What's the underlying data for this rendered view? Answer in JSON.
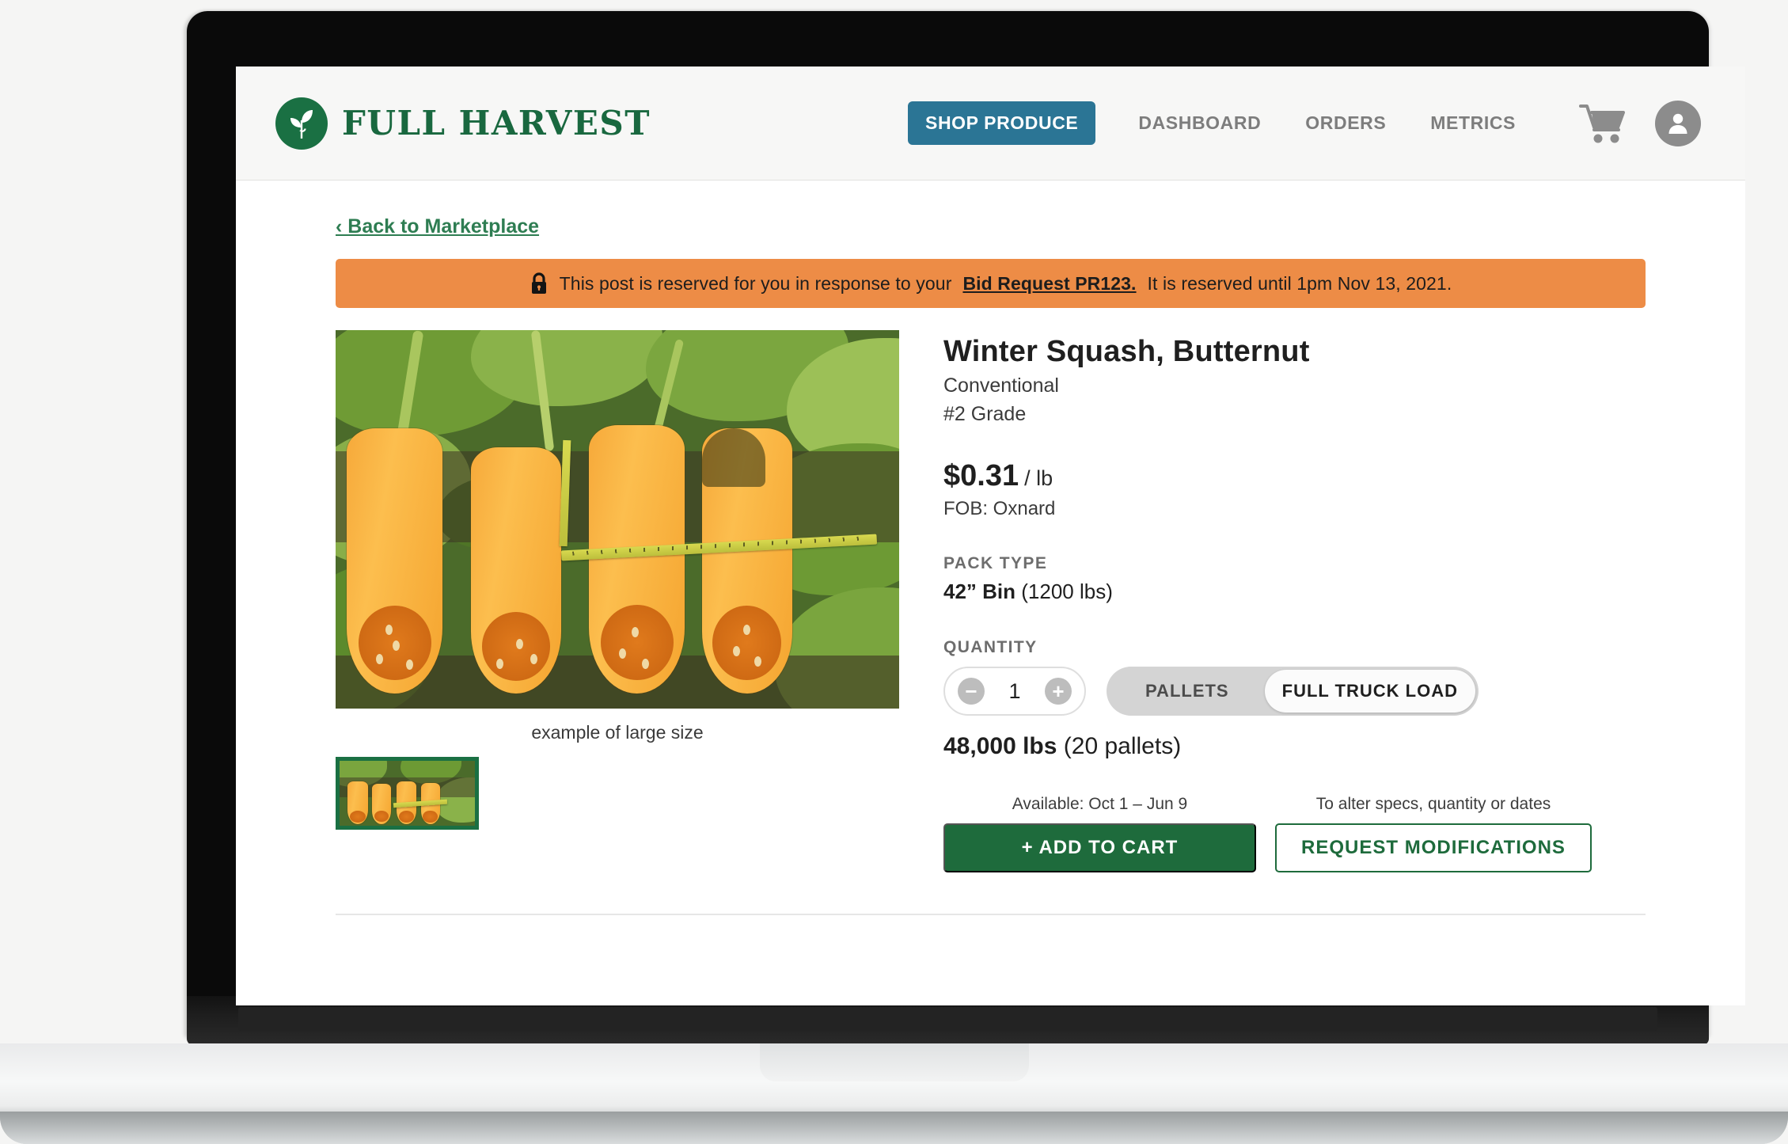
{
  "header": {
    "brand_name": "FULL HARVEST",
    "brand_mark_icon": "sprout-leaf-icon",
    "nav": [
      {
        "label": "SHOP PRODUCE",
        "active": true
      },
      {
        "label": "DASHBOARD",
        "active": false
      },
      {
        "label": "ORDERS",
        "active": false
      },
      {
        "label": "METRICS",
        "active": false
      }
    ],
    "cart_icon": "shopping-cart-icon",
    "account_icon": "user-avatar-icon"
  },
  "page": {
    "back_link": "‹ Back to Marketplace",
    "banner": {
      "lock_icon": "lock-icon",
      "text_before": "This post is reserved for you in response to your",
      "link_text": "Bid Request PR123.",
      "text_after": "It is reserved until 1pm Nov 13, 2021."
    }
  },
  "gallery": {
    "caption": "example of large size",
    "thumbnail_alt": "butternut squash halves thumbnail"
  },
  "product": {
    "title": "Winter Squash, Butternut",
    "growing_method": "Conventional",
    "grade": "#2 Grade",
    "price": "$0.31",
    "price_unit": "/ lb",
    "fob": "FOB: Oxnard",
    "pack_type_label": "PACK TYPE",
    "pack_type_value_bold": "42” Bin",
    "pack_type_value_rest": "(1200 lbs)",
    "quantity_label": "QUANTITY",
    "quantity_value": "1",
    "decrement_icon": "minus-circle-icon",
    "increment_icon": "plus-circle-icon",
    "unit_options": [
      {
        "label": "PALLETS",
        "selected": false
      },
      {
        "label": "FULL TRUCK LOAD",
        "selected": true
      }
    ],
    "total_bold": "48,000 lbs",
    "total_rest": "(20 pallets)"
  },
  "actions": {
    "availability_note": "Available: Oct 1 – Jun 9",
    "modify_note": "To alter specs, quantity or dates",
    "add_to_cart_label": "+ ADD TO CART",
    "request_modifications_label": "REQUEST MODIFICATIONS"
  },
  "colors": {
    "brand_green": "#19683f",
    "cta_green": "#1e6b3c",
    "nav_active_teal": "#2b7595",
    "banner_orange": "#ed8c46"
  }
}
